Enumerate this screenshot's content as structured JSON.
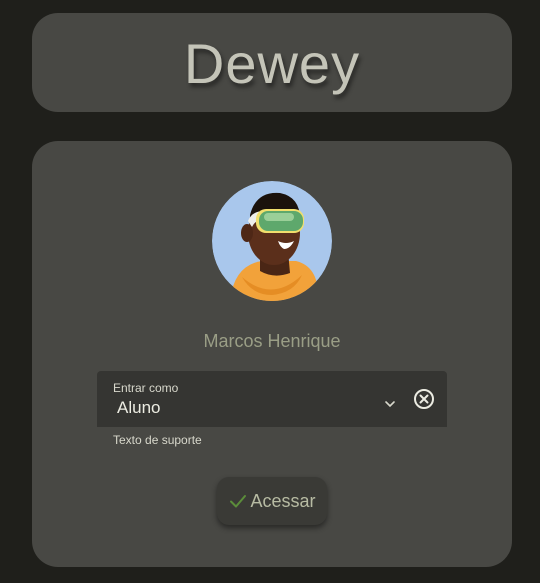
{
  "app": {
    "title": "Dewey"
  },
  "profile": {
    "name": "Marcos Henrique",
    "avatar_alt": "avatar-3d-vr-headset"
  },
  "role_select": {
    "label": "Entrar como",
    "value": "Aluno",
    "support_text": "Texto de suporte",
    "chevron_icon": "chevron-down-icon",
    "clear_icon": "circle-x-icon"
  },
  "actions": {
    "access_label": "Acessar",
    "access_icon": "check-icon"
  },
  "colors": {
    "background": "#1f1f1b",
    "card": "#484844",
    "field": "#353532",
    "title_text": "#c4c4b8",
    "name_text": "#9a9e86",
    "check_green": "#5b8d3a"
  }
}
